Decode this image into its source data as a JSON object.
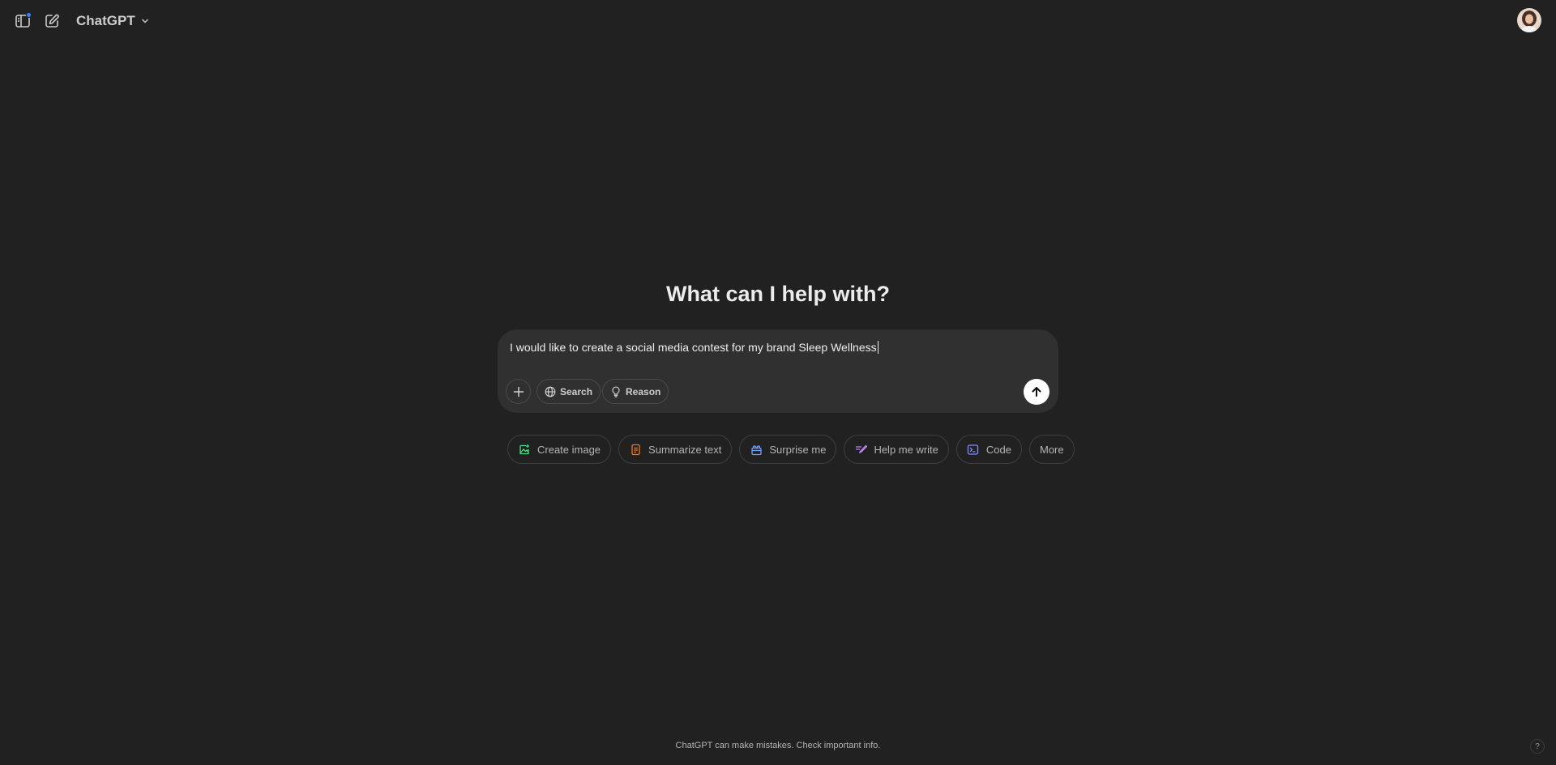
{
  "header": {
    "model_name": "ChatGPT",
    "icons": {
      "sidebar_toggle": "sidebar-toggle-icon",
      "new_chat": "compose-icon",
      "model_dropdown": "chevron-down-icon",
      "avatar": "user-avatar"
    }
  },
  "main": {
    "title": "What can I help with?",
    "composer": {
      "value": "I would like to create a social media contest for my brand Sleep Wellness",
      "tools": [
        {
          "label": "Search",
          "icon": "globe-icon"
        },
        {
          "label": "Reason",
          "icon": "lightbulb-icon"
        }
      ]
    },
    "suggestions": [
      {
        "label": "Create image",
        "icon": "image-icon",
        "color": "#4ade80"
      },
      {
        "label": "Summarize text",
        "icon": "document-icon",
        "color": "#f97316"
      },
      {
        "label": "Surprise me",
        "icon": "gift-icon",
        "color": "#60a5fa"
      },
      {
        "label": "Help me write",
        "icon": "pen-icon",
        "color": "#c084fc"
      },
      {
        "label": "Code",
        "icon": "code-icon",
        "color": "#818cf8"
      },
      {
        "label": "More",
        "icon": ""
      }
    ]
  },
  "footer": {
    "disclaimer": "ChatGPT can make mistakes. Check important info.",
    "help": "?"
  },
  "colors": {
    "background": "#212121",
    "composer": "#303030",
    "accent_dot": "#3b82f6"
  }
}
